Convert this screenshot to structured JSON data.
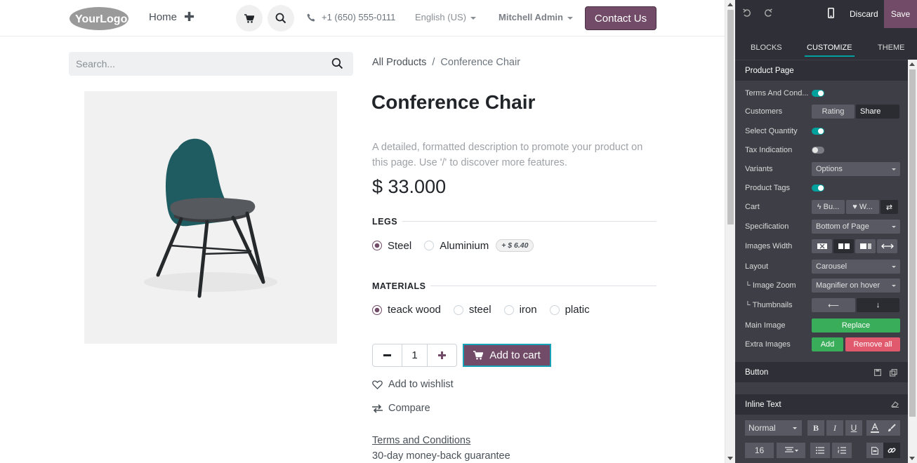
{
  "header": {
    "logo_text": "YourLogo",
    "home": "Home",
    "phone": "+1 (650) 555-0111",
    "language": "English (US)",
    "user": "Mitchell Admin",
    "contact": "Contact Us"
  },
  "search": {
    "placeholder": "Search..."
  },
  "breadcrumb": {
    "parent": "All Products",
    "separator": "/",
    "current": "Conference Chair"
  },
  "product": {
    "title": "Conference Chair",
    "description": "A detailed, formatted description to promote your product on this page. Use '/' to discover more features.",
    "price": "$ 33.000",
    "attributes": [
      {
        "name": "LEGS",
        "options": [
          {
            "label": "Steel",
            "selected": true
          },
          {
            "label": "Aluminium",
            "selected": false,
            "extra": "+ $ 6.40"
          }
        ]
      },
      {
        "name": "MATERIALS",
        "options": [
          {
            "label": "teack wood",
            "selected": true
          },
          {
            "label": "steel",
            "selected": false
          },
          {
            "label": "iron",
            "selected": false
          },
          {
            "label": "platic",
            "selected": false
          }
        ]
      }
    ],
    "quantity": "1",
    "add_to_cart": "Add to cart",
    "wishlist": "Add to wishlist",
    "compare": "Compare",
    "terms": "Terms and Conditions",
    "guarantee": "30-day money-back guarantee"
  },
  "editor": {
    "discard": "Discard",
    "save": "Save",
    "tabs": [
      "BLOCKS",
      "CUSTOMIZE",
      "THEME"
    ],
    "active_tab": "CUSTOMIZE",
    "product_page": {
      "title": "Product Page",
      "terms_label": "Terms And Cond...",
      "customers_label": "Customers",
      "customers_opts": [
        "Rating",
        "Share"
      ],
      "select_qty_label": "Select Quantity",
      "tax_label": "Tax Indication",
      "variants_label": "Variants",
      "variants_value": "Options",
      "tags_label": "Product Tags",
      "cart_label": "Cart",
      "cart_opts": [
        "Bu...",
        "W..."
      ],
      "spec_label": "Specification",
      "spec_value": "Bottom of Page",
      "images_width_label": "Images Width",
      "layout_label": "Layout",
      "layout_value": "Carousel",
      "zoom_label": "└ Image Zoom",
      "zoom_value": "Magnifier on hover",
      "thumbs_label": "└ Thumbnails",
      "main_image_label": "Main Image",
      "replace": "Replace",
      "extra_images_label": "Extra Images",
      "add": "Add",
      "remove_all": "Remove all"
    },
    "button_section": "Button",
    "inline_text": {
      "title": "Inline Text",
      "style": "Normal",
      "bold": "B",
      "italic": "I",
      "underline": "U",
      "font_size": "16"
    }
  },
  "colors": {
    "brand": "#714b67",
    "accent": "#00a09d",
    "focus": "#17a2b8"
  }
}
